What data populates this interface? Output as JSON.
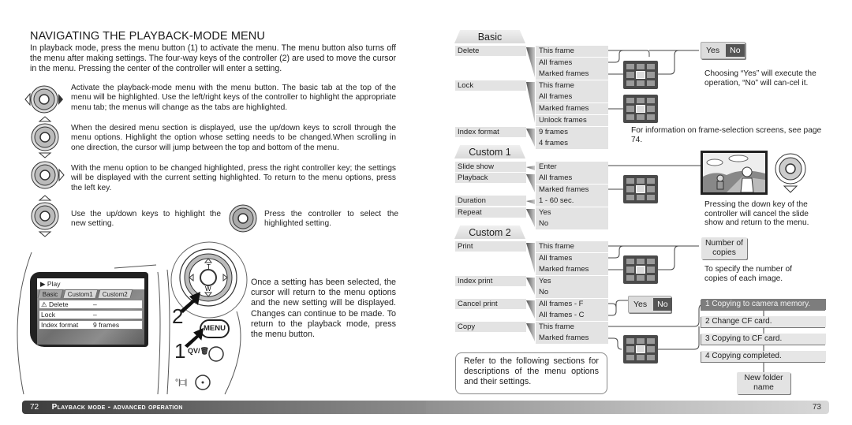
{
  "left_page": {
    "title": "NAVIGATING THE PLAYBACK-MODE MENU",
    "intro": "In playback mode, press the menu button (1) to activate the menu. The menu button also turns off the menu after making settings. The four-way keys of the controller (2) are used to move the cursor in the menu. Pressing the center of the controller will enter a setting.",
    "steps": [
      {
        "icon": "controller-left-right-icon",
        "text": "Activate the playback-mode menu with the menu button. The basic tab at the top of the menu will be highlighted. Use the left/right keys of the controller to highlight the appropriate menu tab; the menus will change as the tabs are highlighted."
      },
      {
        "icon": "controller-up-down-icon",
        "text": "When the desired menu section is displayed, use the up/down keys to scroll through the menu options. Highlight the option whose setting needs to be changed.When scrolling in one direction, the cursor will jump between the top and bottom of the menu."
      },
      {
        "icon": "controller-right-icon",
        "text": "With the menu option to be changed highlighted, press the right controller key; the settings will be displayed with the current setting highlighted. To return to the menu options, press the left key."
      },
      {
        "icon": "controller-up-down-icon",
        "text": "Use the up/down keys to highlight the new setting."
      },
      {
        "icon": "controller-center-icon",
        "text": "Press the controller to select the highlighted setting."
      }
    ],
    "camera": {
      "screen_title": "Play",
      "tabs": [
        "Basic",
        "Custom1",
        "Custom2"
      ],
      "rows": [
        {
          "label": "Delete",
          "value": "–"
        },
        {
          "label": "Lock",
          "value": "–"
        },
        {
          "label": "Index format",
          "value": "9 frames"
        }
      ],
      "controller_top": "T",
      "controller_bottom": "W",
      "callout_2": "2",
      "callout_1": "1",
      "menu_button": "MENU",
      "qv_label": "QV/🗑"
    },
    "camera_text": "Once a setting has been selected, the cursor will return to the menu options and the new setting will be displayed. Changes can continue to be made. To return to the playback mode, press the menu button.",
    "footer": {
      "page": "72",
      "section": "Playback mode - advanced operation"
    }
  },
  "right_page": {
    "sections": [
      {
        "name": "Basic",
        "options": [
          {
            "label": "Delete",
            "settings": [
              "This frame",
              "All frames",
              "Marked frames"
            ]
          },
          {
            "label": "Lock",
            "settings": [
              "This frame",
              "All frames",
              "Marked frames",
              "Unlock frames"
            ]
          },
          {
            "label": "Index format",
            "settings": [
              "9 frames",
              "4 frames"
            ]
          }
        ]
      },
      {
        "name": "Custom 1",
        "options": [
          {
            "label": "Slide show",
            "settings": [
              "Enter"
            ]
          },
          {
            "label": "Playback",
            "settings": [
              "All frames",
              "Marked frames"
            ]
          },
          {
            "label": "Duration",
            "settings": [
              "1 - 60 sec."
            ]
          },
          {
            "label": "Repeat",
            "settings": [
              "Yes",
              "No"
            ]
          }
        ]
      },
      {
        "name": "Custom 2",
        "options": [
          {
            "label": "Print",
            "settings": [
              "This frame",
              "All frames",
              "Marked frames"
            ]
          },
          {
            "label": "Index print",
            "settings": [
              "Yes",
              "No"
            ]
          },
          {
            "label": "Cancel print",
            "settings": [
              "All frames - F",
              "All frames - C"
            ]
          },
          {
            "label": "Copy",
            "settings": [
              "This frame",
              "Marked frames"
            ]
          }
        ]
      }
    ],
    "confirm": {
      "yes": "Yes",
      "no": "No"
    },
    "notes": {
      "yes_no": "Choosing “Yes” will execute the operation, “No” will can-cel it.",
      "frame_selection": "For information on frame-selection screens, see page 74.",
      "slide_show": "Pressing the down key of the controller will cancel the slide show and return to the menu.",
      "copies": "To specify the number of copies of each image."
    },
    "number_of_copies": "Number of copies",
    "copy_steps": [
      "1 Copying to camera memory.",
      "2 Change CF card.",
      "3 Copying to CF card.",
      "4 Copying completed."
    ],
    "new_folder": "New folder name",
    "refer": "Refer to the following sections for descriptions of the menu options and their settings.",
    "footer": {
      "page": "73"
    }
  }
}
